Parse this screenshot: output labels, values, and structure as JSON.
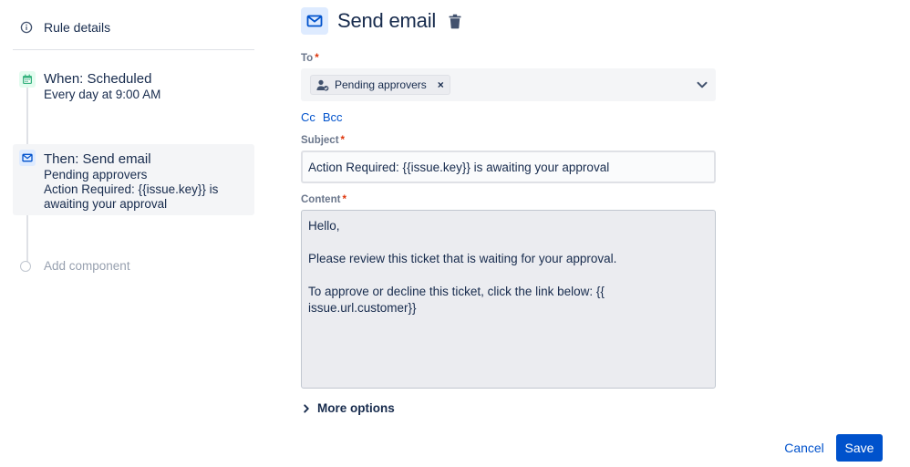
{
  "sidebar": {
    "rule_details_label": "Rule details",
    "trigger": {
      "title": "When: Scheduled",
      "subtitle": "Every day at 9:00 AM",
      "icon": "calendar-icon"
    },
    "action": {
      "title": "Then: Send email",
      "line1": "Pending approvers",
      "line2": "Action Required: {{issue.key}} is",
      "line3": "awaiting your approval",
      "icon": "mail-icon"
    },
    "add_component_label": "Add component"
  },
  "header": {
    "title": "Send email",
    "icon": "mail-icon"
  },
  "form": {
    "to": {
      "label": "To",
      "required_mark": "*",
      "tag_label": "Pending approvers",
      "tag_remove": "×"
    },
    "cc_label": "Cc",
    "bcc_label": "Bcc",
    "subject": {
      "label": "Subject",
      "required_mark": "*",
      "value": "Action Required: {{issue.key}} is awaiting your approval"
    },
    "content": {
      "label": "Content",
      "required_mark": "*",
      "value": "Hello,\n\nPlease review this ticket that is waiting for your approval.\n\nTo approve or decline this ticket, click the link below: {{\nissue.url.customer}}"
    },
    "more_options_label": "More options"
  },
  "footer": {
    "cancel_label": "Cancel",
    "save_label": "Save"
  },
  "colors": {
    "primary": "#0052cc",
    "required": "#de350b",
    "text": "#172b4d",
    "trigger_badge": "#e3fcef",
    "action_badge": "#deebff"
  }
}
